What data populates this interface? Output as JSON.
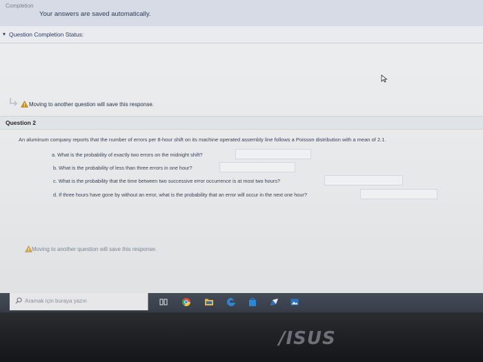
{
  "completion": {
    "title": "Completion",
    "message": "Your answers are saved automatically."
  },
  "status": {
    "bullet": "▾",
    "label": "Question Completion Status:"
  },
  "save_notice": "Moving to another question will save this response.",
  "question": {
    "header": "Question 2",
    "body": "An aluminum company reports that the number of errors per 8-hour shift on its machine operated assembly line follows a Poisson distribution with a mean of 2.1.",
    "parts": [
      {
        "text": "a. What is the probability of exactly two errors on the midnight shift?",
        "answer": ""
      },
      {
        "text": "b. What is the probability of less than three errors in one hour?",
        "answer": ""
      },
      {
        "text": "c. What is the probability that the time between two successive error occurrence is at most two hours?",
        "answer": ""
      },
      {
        "text": "d. If three hours have gone by without an error, what is the probability that an error will occur in the next one hour?",
        "answer": ""
      }
    ]
  },
  "taskbar": {
    "search_placeholder": "Aramak için buraya yazın",
    "icons": [
      "task-view-icon",
      "chrome-icon",
      "file-explorer-icon",
      "edge-icon",
      "store-icon",
      "mail-icon",
      "photos-icon"
    ]
  },
  "brand": "/ISUS",
  "colors": {
    "screen_bg": "#eceef0",
    "completion_bg": "#d7dbe5",
    "text_dark": "#2e3b55",
    "taskbar_bg": "#3b424d",
    "bezel": "#1d1f22",
    "warning": "#d9951b"
  }
}
